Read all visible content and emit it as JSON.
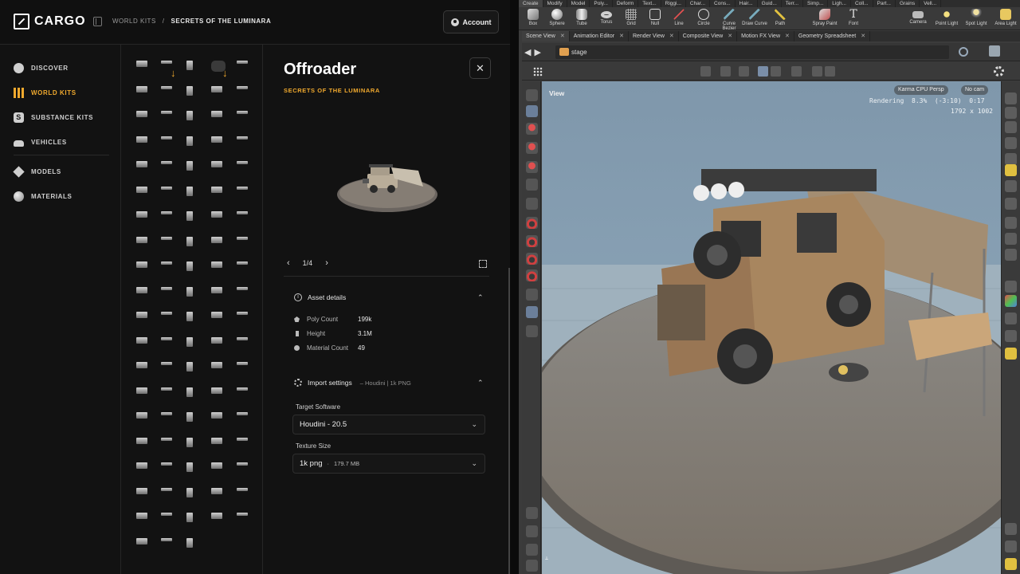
{
  "cargo": {
    "logo": "CARGO",
    "breadcrumb": {
      "root": "WORLD KITS",
      "sep": "/",
      "current": "SECRETS OF THE LUMINARA"
    },
    "account_label": "Account",
    "nav": [
      {
        "label": "DISCOVER",
        "icon": "compass-icon",
        "active": false
      },
      {
        "label": "WORLD KITS",
        "icon": "world-kits-icon",
        "active": true
      },
      {
        "label": "SUBSTANCE KITS",
        "icon": "substance-icon",
        "active": false
      },
      {
        "label": "VEHICLES",
        "icon": "car-icon",
        "active": false
      },
      {
        "label": "MODELS",
        "icon": "cube-icon",
        "active": false
      },
      {
        "label": "MATERIALS",
        "icon": "sphere-icon",
        "active": false
      }
    ],
    "detail": {
      "title": "Offroader",
      "subtitle": "SECRETS OF THE LUMINARA",
      "pager": "1/4",
      "asset_details_label": "Asset details",
      "rows": [
        {
          "label": "Poly Count",
          "value": "199k"
        },
        {
          "label": "Height",
          "value": "3.1M"
        },
        {
          "label": "Material Count",
          "value": "49"
        }
      ],
      "import_label": "Import settings",
      "import_note": "– Houdini | 1k PNG",
      "target_software_label": "Target Software",
      "target_software_value": "Houdini - 20.5",
      "texture_size_label": "Texture Size",
      "texture_size_value": "1k png",
      "texture_size_sep": "·",
      "texture_size_bytes": "179.7 MB"
    },
    "colors": {
      "accent": "#f0a92e",
      "bg": "#121212"
    }
  },
  "houdini": {
    "shelf_tabs": [
      "Create",
      "Modify",
      "Model",
      "Poly...",
      "Deform",
      "Text...",
      "Riggi...",
      "Char...",
      "Cons...",
      "Hair...",
      "Guid...",
      "Terr...",
      "Simp...",
      "Ligh...",
      "Coll...",
      "Part...",
      "Grains",
      "Vell..."
    ],
    "shelf_tools": [
      "Box",
      "Sphere",
      "Tube",
      "Torus",
      "Grid",
      "Null",
      "Line",
      "Circle",
      "Curve Bezier",
      "Draw Curve",
      "Path",
      "Spray Paint",
      "Font"
    ],
    "light_tools": [
      "Camera",
      "Point Light",
      "Spot Light",
      "Area Light"
    ],
    "pane_tabs": [
      "Scene View",
      "Animation Editor",
      "Render View",
      "Composite View",
      "Motion FX View",
      "Geometry Spreadsheet"
    ],
    "path": "stage",
    "viewport": {
      "title": "View",
      "renderer": "Karma CPU",
      "camera_mode": "Persp",
      "camera": "No cam",
      "status": "Rendering",
      "progress": "8.3%",
      "time_left": "(-3:10)",
      "elapsed": "0:17",
      "resolution": "1792 x 1002"
    }
  }
}
